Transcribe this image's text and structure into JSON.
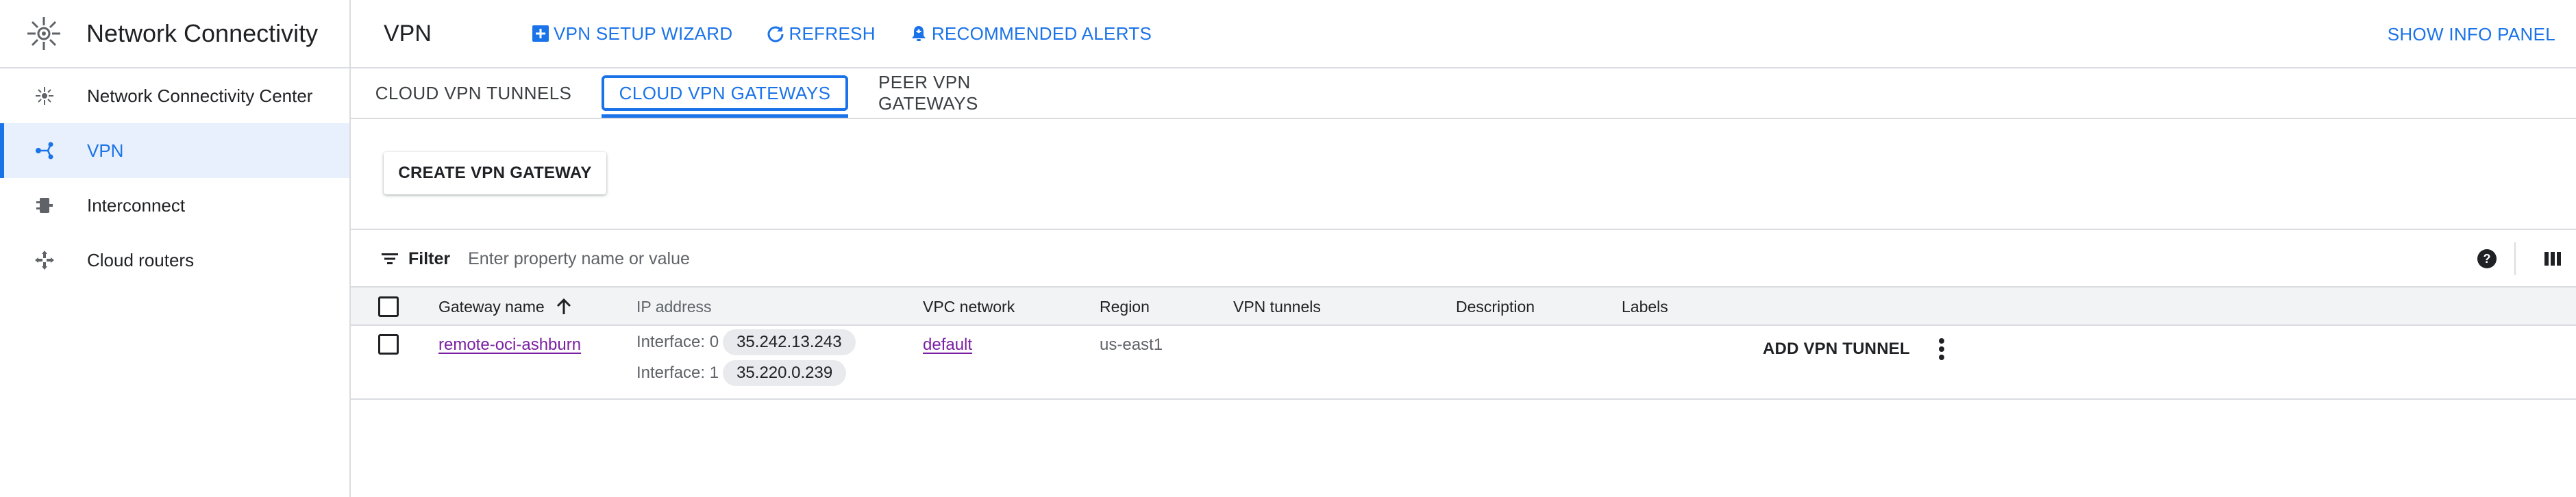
{
  "app": {
    "product_name": "Network Connectivity",
    "logo_icon": "network-connectivity-icon"
  },
  "sidebar": {
    "items": [
      {
        "label": "Network Connectivity Center",
        "icon": "hub-icon",
        "active": false
      },
      {
        "label": "VPN",
        "icon": "vpn-icon",
        "active": true
      },
      {
        "label": "Interconnect",
        "icon": "interconnect-icon",
        "active": false
      },
      {
        "label": "Cloud routers",
        "icon": "router-icon",
        "active": false
      }
    ]
  },
  "header": {
    "title": "VPN",
    "actions": [
      {
        "label": "VPN SETUP WIZARD",
        "icon": "add-box-icon"
      },
      {
        "label": "REFRESH",
        "icon": "refresh-icon"
      },
      {
        "label": "RECOMMENDED ALERTS",
        "icon": "alert-bell-icon"
      }
    ],
    "info_panel_label": "SHOW INFO PANEL"
  },
  "tabs": [
    {
      "label": "CLOUD VPN TUNNELS",
      "active": false
    },
    {
      "label": "CLOUD VPN GATEWAYS",
      "active": true
    },
    {
      "label": "PEER VPN GATEWAYS",
      "active": false
    }
  ],
  "create_button": {
    "label": "CREATE VPN GATEWAY"
  },
  "filter": {
    "label": "Filter",
    "placeholder": "Enter property name or value"
  },
  "table": {
    "columns": [
      "Gateway name",
      "IP address",
      "VPC network",
      "Region",
      "VPN tunnels",
      "Description",
      "Labels"
    ],
    "sorted_column": "Gateway name",
    "sort_direction": "ascending",
    "rows": [
      {
        "gateway_name": "remote-oci-ashburn",
        "interfaces": [
          {
            "label": "Interface: 0",
            "ip": "35.242.13.243"
          },
          {
            "label": "Interface: 1",
            "ip": "35.220.0.239"
          }
        ],
        "vpc_network": "default",
        "region": "us-east1",
        "vpn_tunnels": "",
        "description": "",
        "labels": "",
        "action_label": "ADD VPN TUNNEL"
      }
    ]
  },
  "colors": {
    "accent": "#1a73e8",
    "link_visited": "#7b1fa2",
    "active_nav_bg": "#e8f0fe",
    "header_bg": "#f1f3f4",
    "chip_bg": "#e8eaed",
    "border": "#dadce0"
  }
}
